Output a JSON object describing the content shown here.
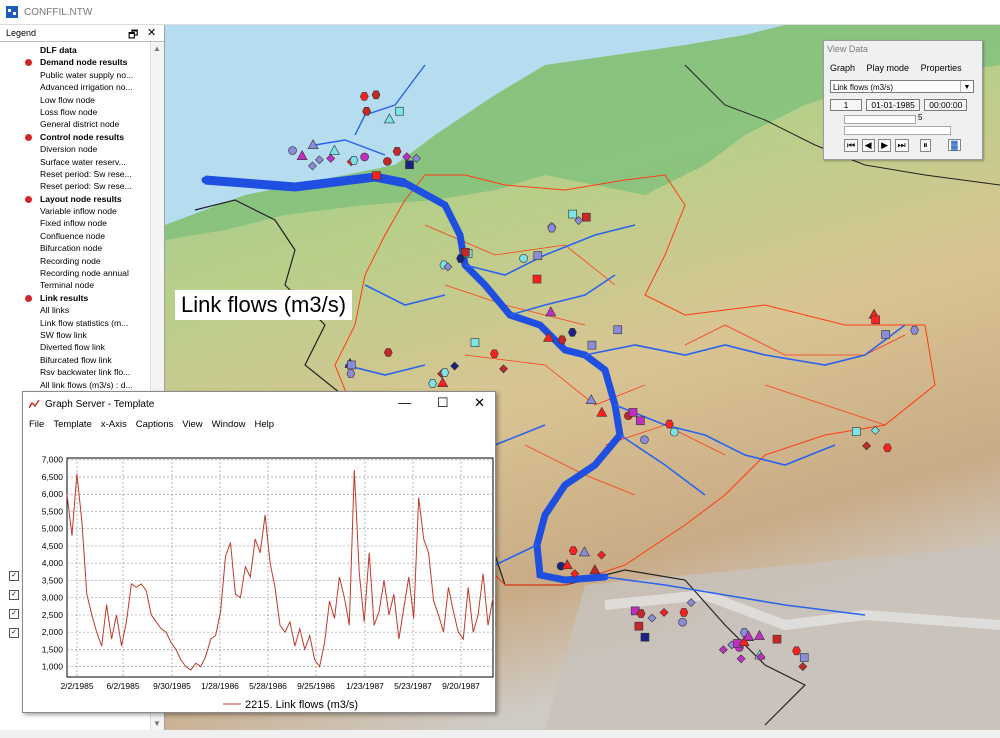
{
  "window": {
    "title": "CONFFIL.NTW",
    "app_icon": "network-icon"
  },
  "legend": {
    "title": "Legend",
    "header_icons": [
      "legend-options-icon",
      "close-icon"
    ],
    "items": [
      {
        "kind": "cat",
        "label": "DLF data",
        "dot": false
      },
      {
        "kind": "grp",
        "label": "Demand node results",
        "dot": true
      },
      {
        "kind": "sub",
        "label": "Public water supply no..."
      },
      {
        "kind": "sub",
        "label": "Advanced irrigation no..."
      },
      {
        "kind": "sub",
        "label": "Low flow node"
      },
      {
        "kind": "sub",
        "label": "Loss flow node"
      },
      {
        "kind": "sub",
        "label": "General district node"
      },
      {
        "kind": "grp",
        "label": "Control node results",
        "dot": true
      },
      {
        "kind": "sub",
        "label": "Diversion node"
      },
      {
        "kind": "sub",
        "label": "Surface water reserv..."
      },
      {
        "kind": "sub",
        "label": "Reset period: Sw rese..."
      },
      {
        "kind": "sub",
        "label": "Reset period: Sw rese..."
      },
      {
        "kind": "grp",
        "label": "Layout node results",
        "dot": true
      },
      {
        "kind": "sub",
        "label": "Variable inflow node"
      },
      {
        "kind": "sub",
        "label": "Fixed inflow node"
      },
      {
        "kind": "sub",
        "label": "Confluence node"
      },
      {
        "kind": "sub",
        "label": "Bifurcation node"
      },
      {
        "kind": "sub",
        "label": "Recording node"
      },
      {
        "kind": "sub",
        "label": "Recording node annual"
      },
      {
        "kind": "sub",
        "label": "Terminal node"
      },
      {
        "kind": "grp",
        "label": "Link results",
        "dot": true
      },
      {
        "kind": "sub",
        "label": "All links"
      },
      {
        "kind": "sub",
        "label": "Link flow statistics (m..."
      },
      {
        "kind": "sub",
        "label": "SW flow link"
      },
      {
        "kind": "sub",
        "label": "Diverted flow link"
      },
      {
        "kind": "sub",
        "label": "Bifurcated flow link"
      },
      {
        "kind": "sub",
        "label": "Rsv backwater link flo..."
      },
      {
        "kind": "sub",
        "label": "All link flows (m3/s) : d..."
      }
    ],
    "checkboxes": [
      true,
      true,
      true,
      true
    ]
  },
  "map": {
    "overlay_label": "Link flows (m3/s)",
    "colors": {
      "sea": "#b6dcef",
      "river": "#1f4fe0",
      "basin": "#ff3b14",
      "border": "#222222"
    }
  },
  "view_data": {
    "title": "View Data",
    "menu": [
      "Graph",
      "Play mode",
      "Properties"
    ],
    "selected_layer": "Link flows (m3/s)",
    "step": "1",
    "date": "01-01-1985",
    "time": "00:00:00",
    "speed": "5",
    "controls": [
      "first-icon",
      "prev-icon",
      "next-icon",
      "last-icon",
      "pause-icon",
      "chart-icon"
    ]
  },
  "graph_window": {
    "title": "Graph Server  - Template",
    "window_buttons": [
      "minimize-icon",
      "maximize-icon",
      "close-icon"
    ],
    "menu": [
      "File",
      "Template",
      "x-Axis",
      "Captions",
      "View",
      "Window",
      "Help"
    ],
    "legend_label": "2215. Link flows (m3/s)",
    "series_color": "#c0392b"
  },
  "chart_data": {
    "type": "line",
    "title": "",
    "xlabel": "",
    "ylabel": "",
    "x_ticks": [
      "2/2/1985",
      "6/2/1985",
      "9/30/1985",
      "1/28/1986",
      "5/28/1986",
      "9/25/1986",
      "1/23/1987",
      "5/23/1987",
      "9/20/1987"
    ],
    "y_ticks": [
      "1,000",
      "1,500",
      "2,000",
      "2,500",
      "3,000",
      "3,500",
      "4,000",
      "4,500",
      "5,000",
      "5,500",
      "6,000",
      "6,500",
      "7,000"
    ],
    "ylim": [
      700,
      7050
    ],
    "grid": true,
    "series": [
      {
        "name": "2215. Link flows (m3/s)",
        "values": [
          6000,
          4800,
          6600,
          5200,
          3100,
          2500,
          2000,
          1600,
          2800,
          1800,
          2500,
          1600,
          2300,
          3400,
          3300,
          3400,
          3200,
          2500,
          2300,
          2100,
          2000,
          1700,
          1500,
          1200,
          1000,
          900,
          1100,
          1000,
          1300,
          1800,
          1900,
          2600,
          4200,
          4600,
          3100,
          3000,
          3900,
          3600,
          4700,
          4300,
          5400,
          4000,
          3300,
          2200,
          2000,
          2300,
          1600,
          2100,
          1500,
          1900,
          1200,
          1000,
          1700,
          2900,
          2400,
          3600,
          3000,
          2200,
          6700,
          3700,
          2300,
          4300,
          2200,
          2600,
          3500,
          2500,
          3100,
          1800,
          2700,
          3600,
          2400,
          5900,
          4700,
          4300,
          2900,
          2500,
          2000,
          3300,
          2600,
          2000,
          1800,
          3300,
          2000,
          2500,
          3700,
          2200,
          3000
        ]
      }
    ]
  }
}
